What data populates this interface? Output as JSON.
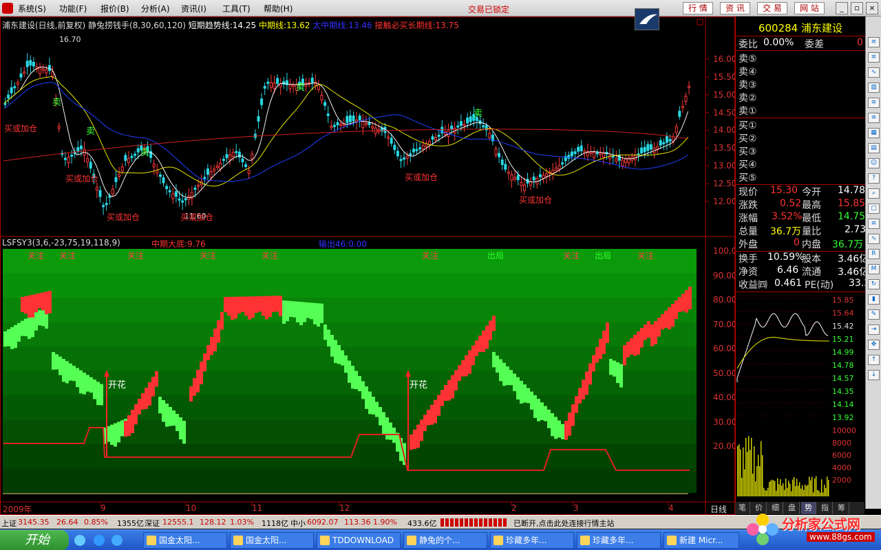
{
  "menubar": {
    "items": [
      "系统(S)",
      "功能(F)",
      "报价(B)",
      "分析(A)",
      "资讯(I)",
      "工具(T)",
      "帮助(H)"
    ],
    "lock_text": "交易已锁定",
    "quick_buttons": [
      "行 情",
      "资 讯",
      "交 易",
      "网 站"
    ],
    "window_buttons": [
      "_",
      "▫",
      "×"
    ]
  },
  "main_chart": {
    "header": {
      "title": "浦东建设(日线,前复权)",
      "indicator": "静兔捞钱手(8,30,60,120)",
      "short": "短期趋势线:14.25",
      "mid": "中期线:13.62",
      "mid_big": "太中期线:13.46",
      "long": "接触必买长期线:13.75"
    },
    "high_label": "16.70",
    "low_label": "11.60",
    "price_ticks": [
      "16.00",
      "15.50",
      "15.00",
      "14.50",
      "14.00",
      "13.50",
      "13.00",
      "12.50",
      "12.00"
    ],
    "buy_label": "买或加仓",
    "sell_label": "卖"
  },
  "sub_chart": {
    "header": {
      "title": "LSFSY3(3,6,-23,75,19,118,9)",
      "mid_bottom": "中期大底:9.76",
      "output": "输出46:0.00"
    },
    "signals": [
      "关注",
      "关注",
      "关注",
      "关注",
      "关注",
      "关注",
      "出局",
      "关注",
      "出局",
      "关注"
    ],
    "bloom_label": "开花",
    "y_ticks": [
      "100.00",
      "90.00",
      "80.00",
      "70.00",
      "60.00",
      "50.00",
      "40.00",
      "30.00",
      "20.00"
    ]
  },
  "x_axis": {
    "labels": [
      "2009年",
      "9",
      "10",
      "11",
      "12",
      "2",
      "3",
      "4"
    ],
    "period": "日线"
  },
  "quote": {
    "code": "600284",
    "name": "浦东建设",
    "weibi_label": "委比",
    "weibi_value": "0.00%",
    "weicha_label": "委差",
    "weicha_value": "0",
    "sell_levels": [
      "卖⑤",
      "卖④",
      "卖③",
      "卖②",
      "卖①"
    ],
    "buy_levels": [
      "买①",
      "买②",
      "买③",
      "买④",
      "买⑤"
    ],
    "rows": [
      {
        "l1": "现价",
        "v1": "15.30",
        "l2": "今开",
        "v2": "14.78"
      },
      {
        "l1": "涨跌",
        "v1": "0.52",
        "l2": "最高",
        "v2": "15.85"
      },
      {
        "l1": "涨幅",
        "v1": "3.52%",
        "l2": "最低",
        "v2": "14.75"
      },
      {
        "l1": "总量",
        "v1": "36.7万",
        "l2": "量比",
        "v2": "2.73"
      },
      {
        "l1": "外盘",
        "v1": "0",
        "l2": "内盘",
        "v2": "36.7万"
      },
      {
        "l1": "换手",
        "v1": "10.59%",
        "l2": "股本",
        "v2": "3.46亿"
      },
      {
        "l1": "净资",
        "v1": "6.46",
        "l2": "流通",
        "v2": "3.46亿"
      },
      {
        "l1": "收益㈣",
        "v1": "0.461",
        "l2": "PE(动)",
        "v2": "33.2"
      }
    ],
    "mini_price_ticks": [
      "15.85",
      "15.64",
      "15.42",
      "15.21",
      "14.99",
      "14.78",
      "14.57",
      "14.35",
      "14.14",
      "13.92"
    ],
    "mini_vol_ticks": [
      "10000",
      "8000",
      "6000",
      "4000",
      "2000"
    ],
    "tabs": [
      "笔",
      "价",
      "细",
      "盘",
      "势",
      "指",
      "筹"
    ]
  },
  "statusbar": {
    "sh_label": "上证",
    "sh_index": "3145.35",
    "sh_change": "26.64",
    "sh_pct": "0.85%",
    "sh_amount": "1355亿",
    "sz_label": "深证",
    "sz_index": "12555.1",
    "sz_change": "128.12",
    "sz_pct": "1.03%",
    "sz_amount": "1118亿",
    "zx_label": "中小",
    "zx_index": "6092.07",
    "zx_change": "113.36",
    "zx_pct": "1.90%",
    "zx_amount": "433.6亿",
    "message": "已断开,点击此处连接行情主站"
  },
  "taskbar": {
    "start": "开始",
    "items": [
      "国金太阳...",
      "国金太阳...",
      "TDDOWNLOAD",
      "静兔的个...",
      "珍藏多年...",
      "珍藏多年...",
      "新建 Micr..."
    ]
  },
  "watermark": {
    "text": "分析家公式网",
    "url": "www.88gs.com"
  }
}
